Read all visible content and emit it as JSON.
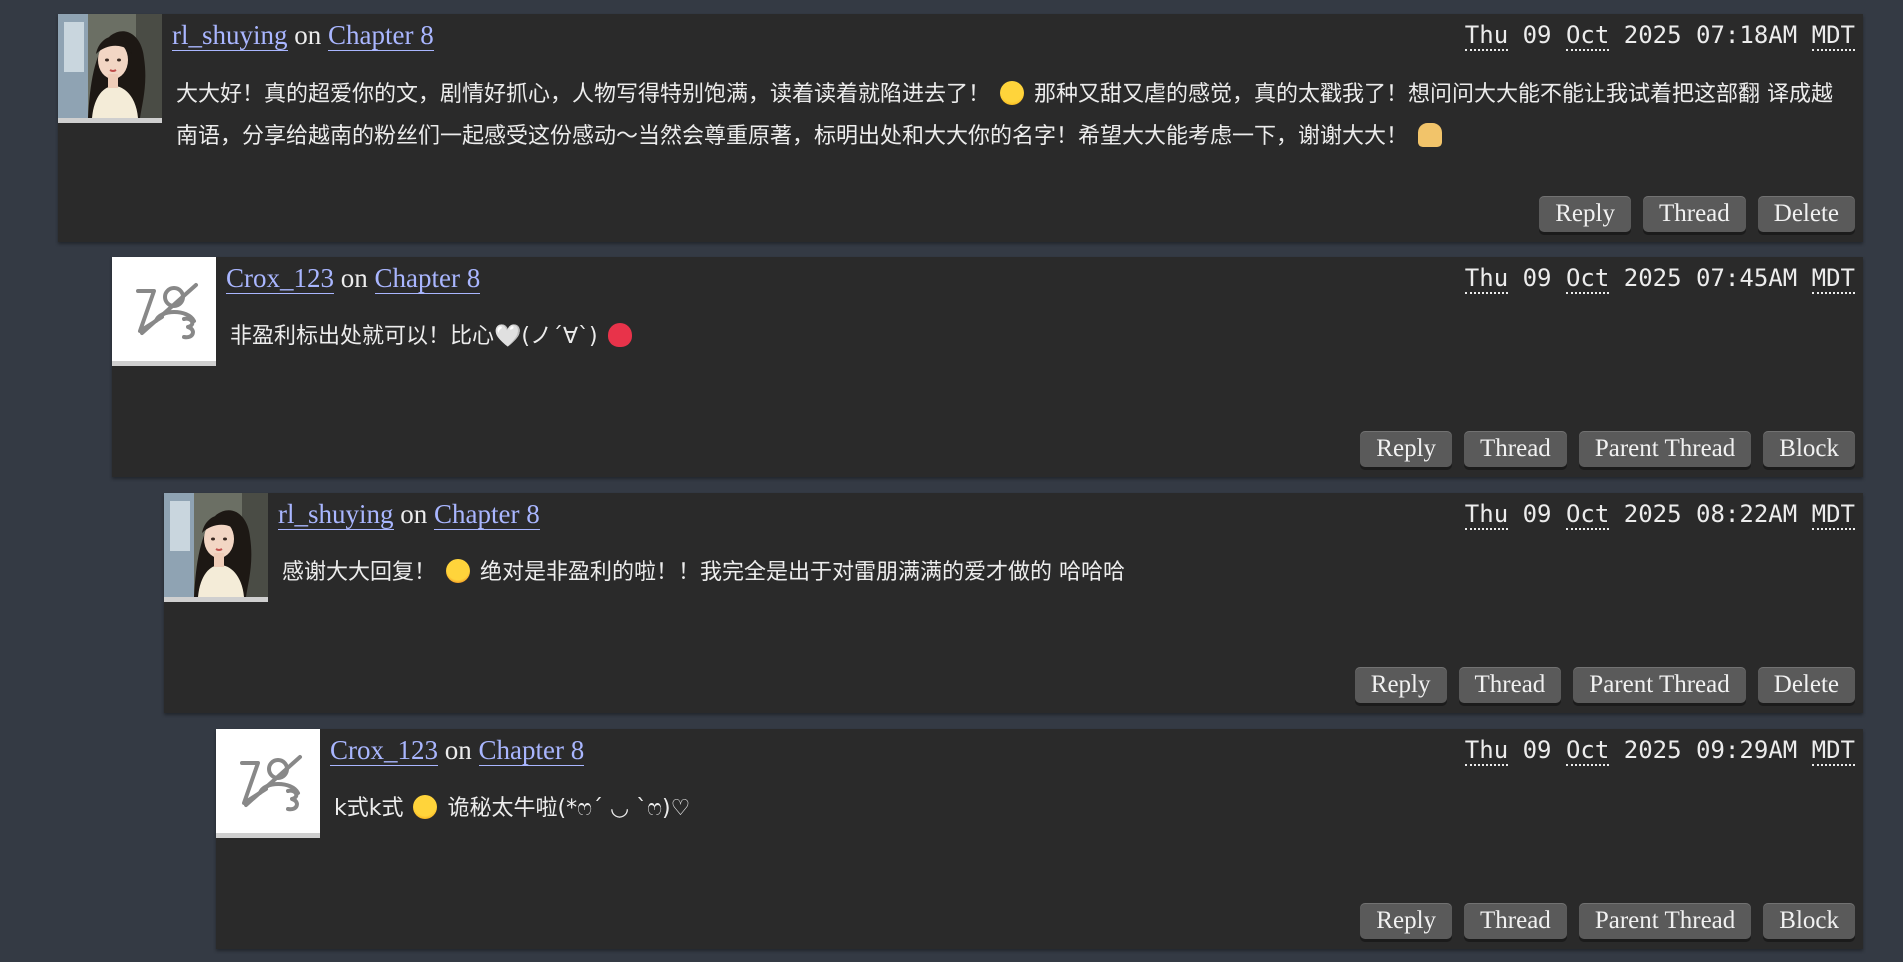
{
  "comments": [
    {
      "author": "rl_shuying",
      "on": "on",
      "chapter": "Chapter 8",
      "date": {
        "day": "Thu",
        "dd": "09",
        "month": "Oct",
        "year": "2025",
        "time": "07:18AM",
        "tz": "MDT"
      },
      "text_1": "大大好！真的超爱你的文，剧情好抓心，人物写得特别饱满，读着读着就陷进去了！",
      "text_2": "那种又甜又虐的感觉，真的太戳我了！想问问大大能不能让我试着把这部翻",
      "text_3": "译成越南语，分享给越南的粉丝们一起感受这份感动～当然会尊重原著，标明出处和大大你的名字！希望大大能考虑一下，谢谢大大！",
      "actions": {
        "reply": "Reply",
        "thread": "Thread",
        "delete": "Delete"
      }
    },
    {
      "author": "Crox_123",
      "on": "on",
      "chapter": "Chapter 8",
      "date": {
        "day": "Thu",
        "dd": "09",
        "month": "Oct",
        "year": "2025",
        "time": "07:45AM",
        "tz": "MDT"
      },
      "text_1": "非盈利标出处就可以！比心🤍(ノ´∀`)",
      "actions": {
        "reply": "Reply",
        "thread": "Thread",
        "parent": "Parent Thread",
        "block": "Block"
      }
    },
    {
      "author": "rl_shuying",
      "on": "on",
      "chapter": "Chapter 8",
      "date": {
        "day": "Thu",
        "dd": "09",
        "month": "Oct",
        "year": "2025",
        "time": "08:22AM",
        "tz": "MDT"
      },
      "text_1": "感谢大大回复！",
      "text_2": "绝对是非盈利的啦！！我完全是出于对雷朋满满的爱才做的 哈哈哈",
      "actions": {
        "reply": "Reply",
        "thread": "Thread",
        "parent": "Parent Thread",
        "delete": "Delete"
      }
    },
    {
      "author": "Crox_123",
      "on": "on",
      "chapter": "Chapter 8",
      "date": {
        "day": "Thu",
        "dd": "09",
        "month": "Oct",
        "year": "2025",
        "time": "09:29AM",
        "tz": "MDT"
      },
      "text_1": "k式k式",
      "text_2": "诡秘太牛啦(*ෆ´ ◡ `ෆ)♡",
      "actions": {
        "reply": "Reply",
        "thread": "Thread",
        "parent": "Parent Thread",
        "block": "Block"
      }
    }
  ],
  "icons": {
    "portrait_avatar": "user-portrait-icon",
    "default_avatar": "default-avatar-icon",
    "emoji_cry": "crying-face-emoji",
    "emoji_pray": "folded-hands-emoji",
    "emoji_heart": "red-heart-emoji",
    "emoji_star_eyes": "star-struck-emoji",
    "emoji_kiss": "face-blowing-kiss-emoji"
  },
  "colors": {
    "page_bg": "#343a44",
    "comment_bg": "#2a2a2a",
    "link": "#a9b6ff",
    "button_bg": "#5a5a5a"
  }
}
